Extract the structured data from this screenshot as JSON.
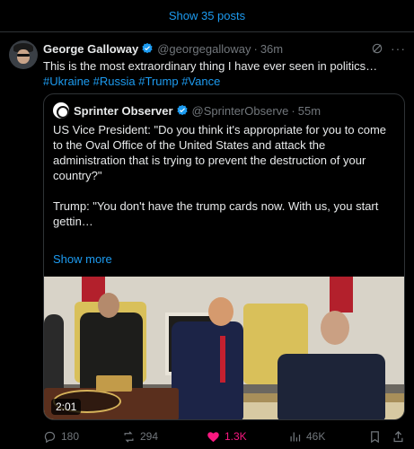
{
  "banner": {
    "show_posts": "Show 35 posts"
  },
  "post": {
    "author": {
      "name": "George Galloway",
      "handle": "@georgegalloway",
      "time": "36m"
    },
    "text_plain": "This is the most extraordinary thing I have ever seen in politics…",
    "tags": [
      "#Ukraine",
      "#Russia",
      "#Trump",
      "#Vance"
    ],
    "quote": {
      "author": {
        "name": "Sprinter Observer",
        "handle": "@SprinterObserve",
        "time": "55m"
      },
      "line1": "US Vice President: \"Do you think it's appropriate for you to come to the Oval Office of the United States and attack the administration that is trying to prevent the destruction of your country?\"",
      "line2": "Trump: \"You don't have the trump cards now. With us, you start gettin…",
      "show_more": "Show more",
      "video_timer": "2:01"
    },
    "actions": {
      "replies": "180",
      "reposts": "294",
      "likes": "1.3K",
      "views": "46K"
    }
  },
  "colors": {
    "accent": "#1d9bf0",
    "like": "#f91880",
    "muted": "#71767b",
    "background": "#000000",
    "border": "#2f3336"
  },
  "icons": {
    "verified": "verified-badge-icon",
    "grok": "grok-icon",
    "more": "more-icon",
    "reply": "reply-icon",
    "repost": "repost-icon",
    "like": "heart-icon",
    "views": "views-icon",
    "bookmark": "bookmark-icon",
    "share": "share-icon"
  }
}
